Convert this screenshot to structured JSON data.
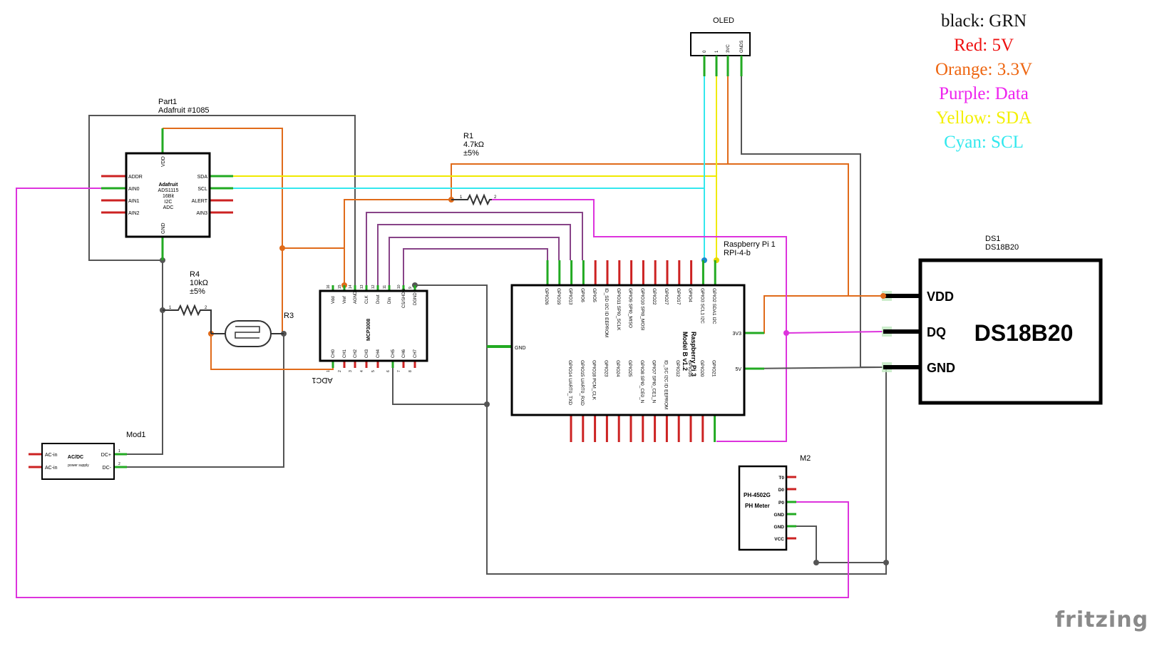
{
  "legend": [
    {
      "text": "black: GRN",
      "color": "#111111"
    },
    {
      "text": "Red: 5V",
      "color": "#ee1111"
    },
    {
      "text": "Orange: 3.3V",
      "color": "#ee6611"
    },
    {
      "text": "Purple: Data",
      "color": "#ee22ee"
    },
    {
      "text": "Yellow: SDA",
      "color": "#f3f000"
    },
    {
      "text": "Cyan: SCL",
      "color": "#33e8ee"
    }
  ],
  "brand": "fritzing",
  "oled": {
    "title": "OLED",
    "pins": [
      "0",
      "1",
      "3VC",
      "GNDS"
    ]
  },
  "adc1115": {
    "ref": "Part1",
    "name": "Adafruit #1085",
    "body": [
      "Adafruit",
      "ADS1115",
      "16Bit",
      "I2C",
      "ADC"
    ],
    "left_pins": [
      "ADDR",
      "AIN0",
      "AIN1",
      "AIN2"
    ],
    "right_pins": [
      "SDA",
      "SCL",
      "ALERT",
      "AIN3"
    ],
    "top_pin": "VDD",
    "bottom_pin": "GND"
  },
  "r1": {
    "ref": "R1",
    "value": "4.7kΩ",
    "tol": "±5%",
    "pin1": "1",
    "pin2": "2"
  },
  "r4": {
    "ref": "R4",
    "value": "10kΩ",
    "tol": "±5%",
    "pin1": "1",
    "pin2": "2"
  },
  "r3": {
    "ref": "R3"
  },
  "mcp": {
    "name": "MCP3008",
    "ref": "ADC1",
    "top_pins": [
      "Vdd",
      "Vref",
      "AGND",
      "CLK",
      "Dout",
      "Din",
      "CS/SHDN",
      "DGND"
    ],
    "top_nums": [
      "16",
      "15",
      "14",
      "13",
      "12",
      "11",
      "10",
      "9"
    ],
    "bottom_pins": [
      "CH0",
      "CH1",
      "CH2",
      "CH3",
      "CH4",
      "CH5",
      "CH6",
      "CH7"
    ],
    "bottom_nums": [
      "1",
      "2",
      "3",
      "4",
      "5",
      "6",
      "7",
      "8"
    ]
  },
  "rpi": {
    "ref": "Raspberry Pi 1",
    "model": "RPI-4-b",
    "body": [
      "Raspberry Pi 3",
      "Model B v1.2"
    ],
    "top_pins": [
      "GPIO26",
      "GPIO19",
      "GPIO13",
      "GPIO6",
      "GPIO5",
      "ID_SD I2C ID EEPROM",
      "GPIO11 SPI0_SCLK",
      "GPIO9 SPI0_MISO",
      "GPIO10 SPI0_MOSI",
      "GPIO22",
      "GPIO27",
      "GPIO17",
      "GPIO4",
      "GPIO3 SCL1 I2C",
      "GPIO2 SDA1 I2C"
    ],
    "bottom_pins": [
      "GPIO14 UART0_TXD",
      "GPIO15 UART0_RXD",
      "GPIO18 PCM_CLK",
      "GPIO23",
      "GPIO24",
      "GPIO25",
      "GPIO8 SPI0_CE0_N",
      "GPIO7 SPI0_CE1_N",
      "ID_SC I2C ID EEPROM",
      "GPIO12",
      "GPIO16",
      "GPIO20",
      "GPIO21"
    ],
    "gnd": "GND",
    "v33": "3V3",
    "v5": "5V"
  },
  "ds": {
    "ref": "DS1",
    "name": "DS18B20",
    "pins": [
      "VDD",
      "DQ",
      "GND"
    ]
  },
  "ph": {
    "ref": "M2",
    "body": [
      "PH-4502G",
      "PH Meter"
    ],
    "pins": [
      "T0",
      "D0",
      "P0",
      "GND",
      "GND",
      "VCC"
    ]
  },
  "psu": {
    "ref": "Mod1",
    "body": [
      "AC/DC",
      "power supply"
    ],
    "left": [
      "AC-in",
      "AC-in"
    ],
    "right": [
      "DC+",
      "DC-"
    ],
    "nums": [
      "1",
      "2"
    ]
  }
}
